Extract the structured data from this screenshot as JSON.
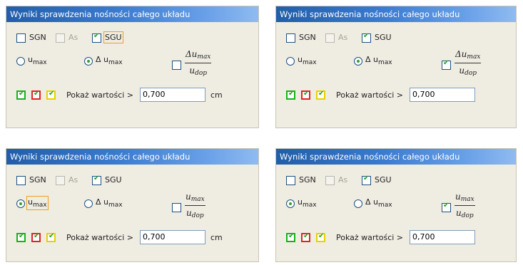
{
  "panel_title": "Wyniki sprawdzenia nośności całego układu",
  "checkboxes": {
    "sgn": "SGN",
    "as": "As",
    "sgu": "SGU"
  },
  "radios": {
    "u_max_symbol": "u",
    "u_max_sub": "max",
    "delta_u_symbol": "Δ u",
    "delta_u_sub": "max"
  },
  "ratio": {
    "num": "Δu",
    "num_sub": "max",
    "den": "u",
    "den_sub": "dop"
  },
  "show_values": {
    "label": "Pokaż wartości >",
    "value": "0,700",
    "unit": "cm"
  },
  "colors": {
    "title_bar": "#3b7bd0",
    "panel_bg": "#efece2",
    "green": "#17b217",
    "red": "#e02323",
    "yellow": "#e6d200"
  },
  "panels": [
    {
      "name": "top-left",
      "sgn_checked": false,
      "sgu_checked": true,
      "sgu_focus": true,
      "selected_radio": "delta_u",
      "u_focus": false,
      "ratio_checked": false,
      "ratio_has_delta": true,
      "show_unit": true
    },
    {
      "name": "top-right",
      "sgn_checked": false,
      "sgu_checked": true,
      "sgu_focus": false,
      "selected_radio": "delta_u",
      "u_focus": false,
      "ratio_checked": true,
      "ratio_has_delta": true,
      "show_unit": false
    },
    {
      "name": "bottom-left",
      "sgn_checked": false,
      "sgu_checked": true,
      "sgu_focus": false,
      "selected_radio": "u_max",
      "u_focus": true,
      "ratio_checked": false,
      "ratio_has_delta": false,
      "show_unit": true
    },
    {
      "name": "bottom-right",
      "sgn_checked": false,
      "sgu_checked": true,
      "sgu_focus": false,
      "selected_radio": "u_max",
      "u_focus": false,
      "ratio_checked": true,
      "ratio_has_delta": false,
      "show_unit": false
    }
  ]
}
